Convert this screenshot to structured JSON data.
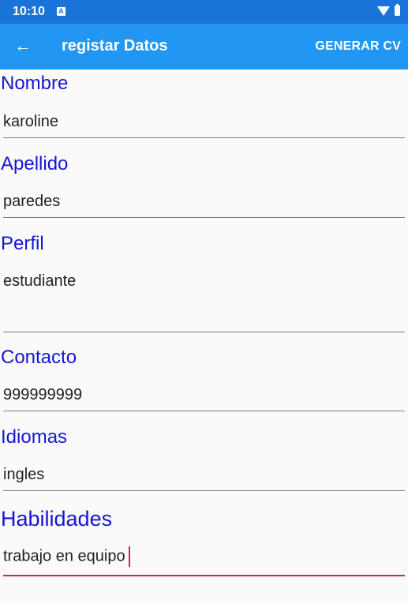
{
  "status_bar": {
    "time": "10:10",
    "notification_icon": "A",
    "icons": [
      "wifi-icon",
      "battery-icon"
    ]
  },
  "app_bar": {
    "back_icon": "arrow-left",
    "title": "registar Datos",
    "action_label": "GENERAR CV"
  },
  "form": {
    "fields": [
      {
        "label": "Nombre",
        "value": "karoline"
      },
      {
        "label": "Apellido",
        "value": "paredes"
      },
      {
        "label": "Perfil",
        "value": "estudiante"
      },
      {
        "label": "Contacto",
        "value": "999999999"
      },
      {
        "label": "Idiomas",
        "value": "ingles"
      },
      {
        "label": "Habilidades",
        "value": "trabajo en equipo",
        "focused": true
      }
    ]
  },
  "colors": {
    "status_bar": "#1a73d9",
    "app_bar": "#2196f3",
    "label": "#1515d6",
    "focus": "#d81b60"
  }
}
